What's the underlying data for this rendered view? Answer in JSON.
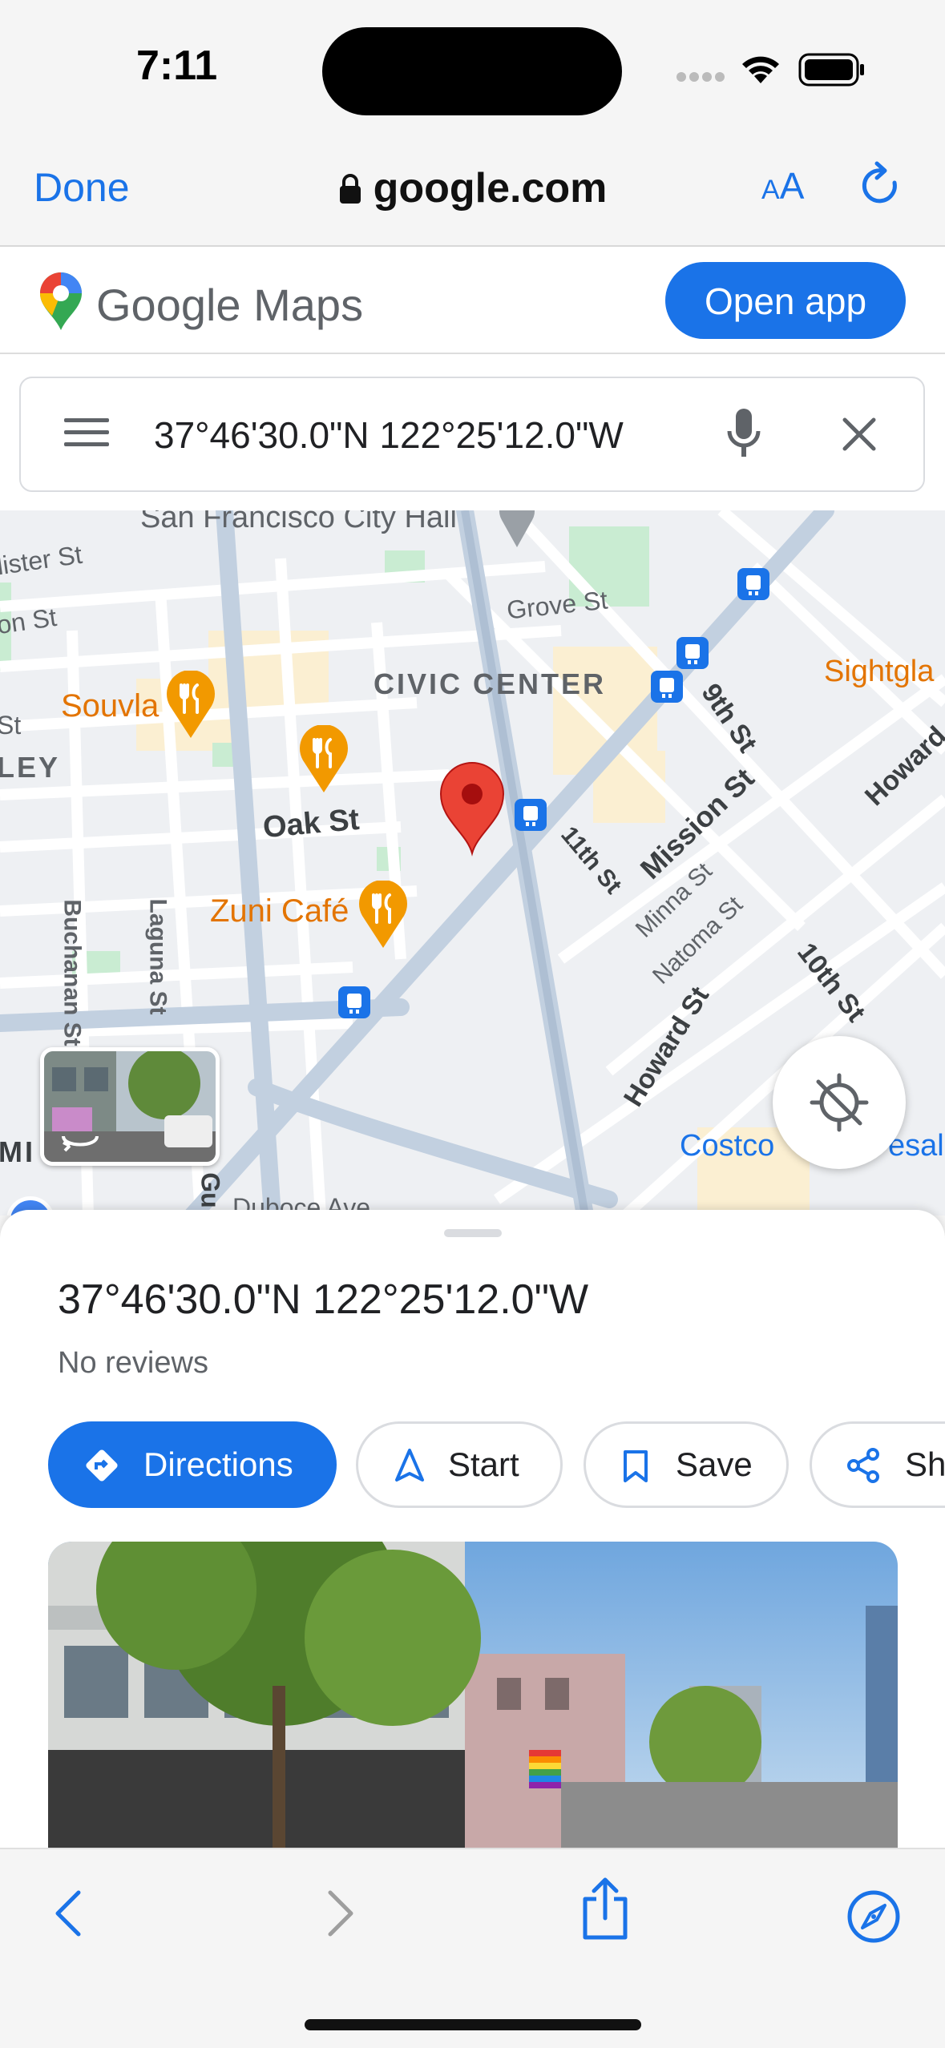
{
  "status": {
    "time": "7:11"
  },
  "browser": {
    "done_label": "Done",
    "url": "google.com",
    "text_size_label": "AA"
  },
  "maps_header": {
    "logo_text": "Google Maps",
    "open_app_label": "Open app"
  },
  "search": {
    "query": "37°46'30.0\"N 122°25'12.0\"W"
  },
  "map": {
    "labels": {
      "city_hall": "San Francisco City Hall",
      "lister_st": "lister St",
      "on_st": "on St",
      "grove_st": "Grove St",
      "civic_center": "CIVIC CENTER",
      "sightglass": "Sightgla",
      "souvla": "Souvla",
      "st": "St",
      "ley": "LEY",
      "ninth_st": "9th St",
      "howard_st_right": "Howard",
      "mission_st": "Mission St",
      "oak_st": "Oak St",
      "eleventh_st": "11th St",
      "minna_st": "Minna St",
      "natoma_st": "Natoma St",
      "zuni_cafe": "Zuni Café",
      "buchanan_st": "Buchanan St",
      "laguna_st": "Laguna St",
      "tenth_st": "10th St",
      "howard_st": "Howard St",
      "costco": "Costco",
      "costco_tail": "esale",
      "mi": "MI",
      "gu": "Gu",
      "duboce": "Duboce Ave"
    }
  },
  "place": {
    "title": "37°46'30.0\"N 122°25'12.0\"W",
    "reviews": "No reviews",
    "actions": {
      "directions": "Directions",
      "start": "Start",
      "save": "Save",
      "share": "Sha"
    }
  },
  "colors": {
    "accent": "#1a73e8",
    "pin": "#ea4335",
    "poi_orange": "#f29900"
  }
}
